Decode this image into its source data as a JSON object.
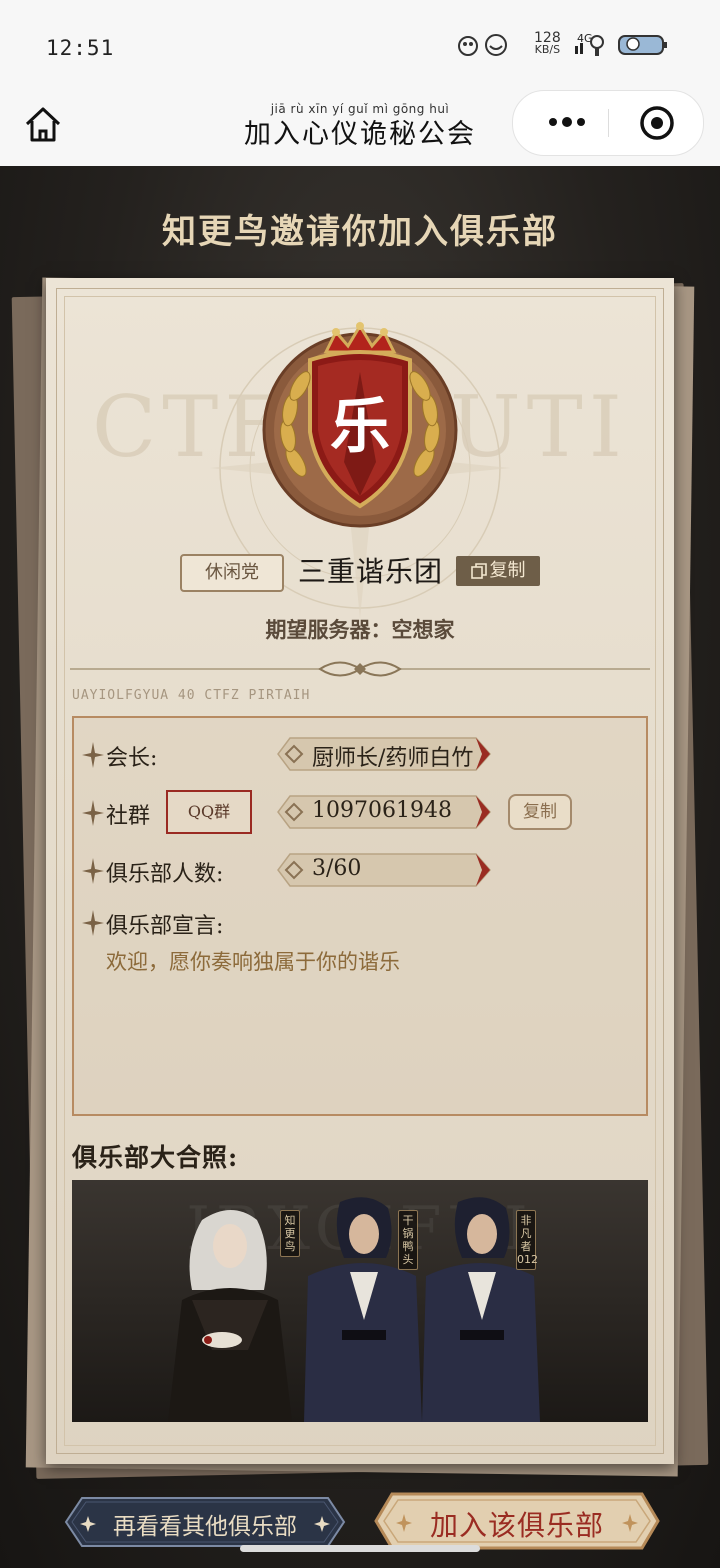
{
  "status_bar": {
    "time": "12:51",
    "net_speed_value": "128",
    "net_speed_unit": "KB/S",
    "signal": "4G"
  },
  "nav": {
    "pinyin": "jiā  rù  xīn  yí  guǐ  mì  gōng huì",
    "title": "加入心仪诡秘公会",
    "more_icon": "more-dots-icon",
    "close_icon": "target-close-icon"
  },
  "invite": {
    "title": "知更鸟邀请你加入俱乐部"
  },
  "club": {
    "emblem_char": "乐",
    "type_badge": "休闲党",
    "name": "三重谐乐团",
    "copy_label": "复制",
    "server": "期望服务器：空想家",
    "cipher_text": "UAYIOLFGYUA 40 CTFZ PIRTAIH",
    "bg_glyphs": "CTFZ  FUTI"
  },
  "info": {
    "leader_label": "会长:",
    "leader_value": "厨师长/药师白竹",
    "group_label": "社群",
    "group_type": "QQ群",
    "group_value": "1097061948",
    "group_copy": "复制",
    "members_label": "俱乐部人数:",
    "members_value": "3/60",
    "manifesto_label": "俱乐部宣言:",
    "manifesto_text": "欢迎，愿你奏响独属于你的谐乐"
  },
  "photo": {
    "label": "俱乐部大合照:",
    "bg_text": "IRXOIFUI",
    "members": [
      "知更鸟",
      "干锅鸭头",
      "非凡者012"
    ]
  },
  "buttons": {
    "other": "再看看其他俱乐部",
    "join": "加入该俱乐部"
  },
  "colors": {
    "accent_red": "#9a2c22",
    "gold": "#c9a25a",
    "paper": "#e6ddcd"
  }
}
